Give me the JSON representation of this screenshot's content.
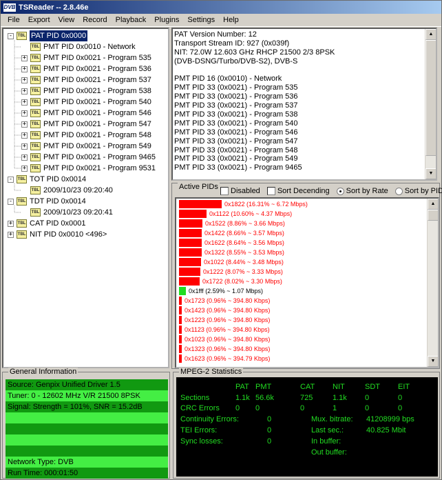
{
  "app": {
    "title": "TSReader -- 2.8.46e",
    "icon_label": "DVB"
  },
  "menu": [
    "File",
    "Export",
    "View",
    "Record",
    "Playback",
    "Plugins",
    "Settings",
    "Help"
  ],
  "tree": {
    "nodes": [
      {
        "label": "PAT PID 0x0000",
        "level": 0,
        "expander": "-",
        "selected": true
      },
      {
        "label": "PMT PID 0x0010 - Network",
        "level": 1,
        "expander": ""
      },
      {
        "label": "PMT PID 0x0021 - Program 535",
        "level": 1,
        "expander": "+"
      },
      {
        "label": "PMT PID 0x0021 - Program 536",
        "level": 1,
        "expander": "+"
      },
      {
        "label": "PMT PID 0x0021 - Program 537",
        "level": 1,
        "expander": "+"
      },
      {
        "label": "PMT PID 0x0021 - Program 538",
        "level": 1,
        "expander": "+"
      },
      {
        "label": "PMT PID 0x0021 - Program 540",
        "level": 1,
        "expander": "+"
      },
      {
        "label": "PMT PID 0x0021 - Program 546",
        "level": 1,
        "expander": "+"
      },
      {
        "label": "PMT PID 0x0021 - Program 547",
        "level": 1,
        "expander": "+"
      },
      {
        "label": "PMT PID 0x0021 - Program 548",
        "level": 1,
        "expander": "+"
      },
      {
        "label": "PMT PID 0x0021 - Program 549",
        "level": 1,
        "expander": "+"
      },
      {
        "label": "PMT PID 0x0021 - Program 9465",
        "level": 1,
        "expander": "+"
      },
      {
        "label": "PMT PID 0x0021 - Program 9531",
        "level": 1,
        "expander": "+"
      },
      {
        "label": "TOT PID 0x0014",
        "level": 0,
        "expander": "-"
      },
      {
        "label": "2009/10/23 09:20:40",
        "level": 1,
        "expander": ""
      },
      {
        "label": "TDT PID 0x0014",
        "level": 0,
        "expander": "-"
      },
      {
        "label": "2009/10/23 09:20:41",
        "level": 1,
        "expander": ""
      },
      {
        "label": "CAT PID 0x0001",
        "level": 0,
        "expander": "+"
      },
      {
        "label": "NIT PID 0x0010 <496>",
        "level": 0,
        "expander": "+"
      }
    ]
  },
  "detail": {
    "lines": [
      "PAT Version Number: 12",
      "Transport Stream ID: 927 (0x039f)",
      "NIT: 72.0W 12.603 GHz RHCP 21500 2/3 8PSK",
      "(DVB-DSNG/Turbo/DVB-S2), DVB-S",
      "",
      "PMT PID 16 (0x0010) - Network",
      "PMT PID 33 (0x0021) - Program 535",
      "PMT PID 33 (0x0021) - Program 536",
      "PMT PID 33 (0x0021) - Program 537",
      "PMT PID 33 (0x0021) - Program 538",
      "PMT PID 33 (0x0021) - Program 540",
      "PMT PID 33 (0x0021) - Program 546",
      "PMT PID 33 (0x0021) - Program 547",
      "PMT PID 33 (0x0021) - Program 548",
      "PMT PID 33 (0x0021) - Program 549",
      "PMT PID 33 (0x0021) - Program 9465"
    ]
  },
  "active_pids": {
    "legend": "Active PIDs",
    "options": {
      "disabled": "Disabled",
      "sort_descending": "Sort Decending",
      "sort_by_rate": "Sort by Rate",
      "sort_by_pid": "Sort by PID"
    },
    "colors": {
      "high": "#ff0000",
      "null": "#22dd22",
      "low": "#ff0000",
      "text_red": "#ff0000",
      "text_black": "#000000"
    },
    "rows": [
      {
        "label": "0x1822 (16.31% ~ 6.72 Mbps)",
        "pct": 16.31,
        "kind": "high"
      },
      {
        "label": "0x1122 (10.60% ~ 4.37 Mbps)",
        "pct": 10.6,
        "kind": "high"
      },
      {
        "label": "0x1522 (8.86% ~ 3.66 Mbps)",
        "pct": 8.86,
        "kind": "high"
      },
      {
        "label": "0x1422 (8.66% ~ 3.57 Mbps)",
        "pct": 8.66,
        "kind": "high"
      },
      {
        "label": "0x1622 (8.64% ~ 3.56 Mbps)",
        "pct": 8.64,
        "kind": "high"
      },
      {
        "label": "0x1322 (8.55% ~ 3.53 Mbps)",
        "pct": 8.55,
        "kind": "high"
      },
      {
        "label": "0x1022 (8.44% ~ 3.48 Mbps)",
        "pct": 8.44,
        "kind": "high"
      },
      {
        "label": "0x1222 (8.07% ~ 3.33 Mbps)",
        "pct": 8.07,
        "kind": "high"
      },
      {
        "label": "0x1722 (8.02% ~ 3.30 Mbps)",
        "pct": 8.02,
        "kind": "high"
      },
      {
        "label": "0x1fff (2.59% ~ 1.07 Mbps)",
        "pct": 2.59,
        "kind": "null"
      },
      {
        "label": "0x1723 (0.96% ~ 394.80 Kbps)",
        "pct": 0.96,
        "kind": "low"
      },
      {
        "label": "0x1423 (0.96% ~ 394.80 Kbps)",
        "pct": 0.96,
        "kind": "low"
      },
      {
        "label": "0x1223 (0.96% ~ 394.80 Kbps)",
        "pct": 0.96,
        "kind": "low"
      },
      {
        "label": "0x1123 (0.96% ~ 394.80 Kbps)",
        "pct": 0.96,
        "kind": "low"
      },
      {
        "label": "0x1023 (0.96% ~ 394.80 Kbps)",
        "pct": 0.96,
        "kind": "low"
      },
      {
        "label": "0x1323 (0.96% ~ 394.80 Kbps)",
        "pct": 0.96,
        "kind": "low"
      },
      {
        "label": "0x1623 (0.96% ~ 394.79 Kbps)",
        "pct": 0.96,
        "kind": "low"
      }
    ]
  },
  "general_info": {
    "legend": "General Information",
    "colors": {
      "dark": "#119911",
      "light": "#44ee44"
    },
    "rows": [
      {
        "text": "Source: Genpix Unified Driver 1.5",
        "shade": "dark"
      },
      {
        "text": "Tuner: 0 - 12602 MHz V/R 21500 8PSK",
        "shade": "light"
      },
      {
        "text": "Signal: Strength = 101%, SNR = 15.2dB",
        "shade": "dark"
      },
      {
        "text": "",
        "shade": "light"
      },
      {
        "text": "",
        "shade": "dark"
      },
      {
        "text": "",
        "shade": "light"
      },
      {
        "text": "",
        "shade": "dark"
      },
      {
        "text": "Network Type: DVB",
        "shade": "light"
      },
      {
        "text": "Run Time: 000:01:50",
        "shade": "dark"
      }
    ]
  },
  "mpeg_stats": {
    "legend": "MPEG-2 Statistics",
    "table_headers": [
      "PAT",
      "PMT",
      "CAT",
      "NIT",
      "SDT",
      "EIT"
    ],
    "sections_label": "Sections",
    "sections": [
      "1.1k",
      "56.6k",
      "725",
      "1.1k",
      "0",
      "0"
    ],
    "crc_label": "CRC Errors",
    "crc": [
      "0",
      "0",
      "0",
      "1",
      "0",
      "0"
    ],
    "continuity_label": "Continuity Errors:",
    "continuity": "0",
    "tei_label": "TEI Errors:",
    "tei": "0",
    "sync_label": "Sync losses:",
    "sync": "0",
    "mux_label": "Mux. bitrate:",
    "mux": "41208999 bps",
    "last_sec_label": "Last sec.:",
    "last_sec": "40.825 Mbit",
    "in_buffer_label": "In buffer:",
    "out_buffer_label": "Out buffer:"
  }
}
